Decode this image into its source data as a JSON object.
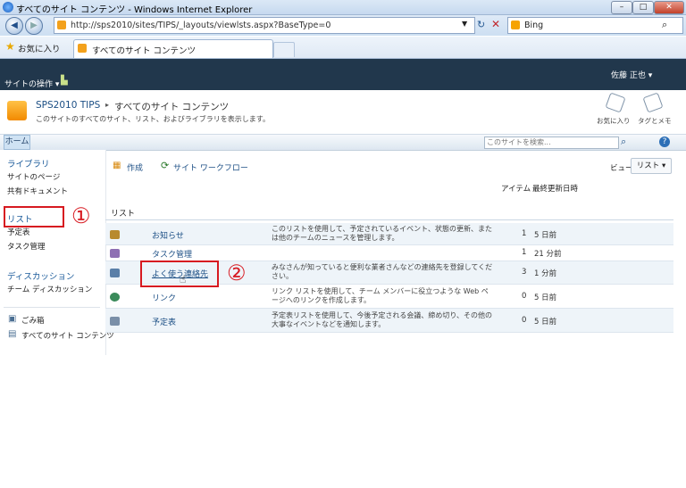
{
  "window": {
    "title": "すべてのサイト コンテンツ - Windows Internet Explorer"
  },
  "browser": {
    "url": "http://sps2010/sites/TIPS/_layouts/viewlsts.aspx?BaseType=0",
    "search_engine": "Bing",
    "favorites_label": "お気に入り",
    "tab_title": "すべてのサイト コンテンツ"
  },
  "ribbon": {
    "site_actions": "サイトの操作 ▾",
    "user": "佐藤 正也 ▾"
  },
  "breadcrumb": {
    "site": "SPS2010 TIPS",
    "separator": "▸",
    "page": "すべてのサイト コンテンツ",
    "description": "このサイトのすべてのサイト、リスト、およびライブラリを表示します。",
    "like": "お気に入り",
    "tags": "タグとメモ"
  },
  "topnav": {
    "home": "ホーム",
    "search_placeholder": "このサイトを検索..."
  },
  "leftnav": {
    "libraries": "ライブラリ",
    "site_pages": "サイトのページ",
    "shared_docs": "共有ドキュメント",
    "lists": "リスト",
    "calendar": "予定表",
    "tasks": "タスク管理",
    "discussions": "ディスカッション",
    "team_discussion": "チーム ディスカッション",
    "recycle_bin": "ごみ箱",
    "all_content": "すべてのサイト コンテンツ"
  },
  "toolbar": {
    "create": "作成",
    "workflow": "サイト ワークフロー",
    "view_label": "ビュー:",
    "view_value": "リスト ▾"
  },
  "columns": {
    "items": "アイテム",
    "modified": "最終更新日時"
  },
  "section": "リスト",
  "lists": [
    {
      "name": "お知らせ",
      "desc": "このリストを使用して、予定されているイベント、状態の更新、または他のチームのニュースを管理します。",
      "count": "1",
      "time": "5 日前"
    },
    {
      "name": "タスク管理",
      "desc": "",
      "count": "1",
      "time": "21 分前"
    },
    {
      "name": "よく使う連絡先",
      "desc": "みなさんが知っていると便利な業者さんなどの連絡先を登録してください。",
      "count": "3",
      "time": "1 分前"
    },
    {
      "name": "リンク",
      "desc": "リンク リストを使用して、チーム メンバーに役立つような Web ページへのリンクを作成します。",
      "count": "0",
      "time": "5 日前"
    },
    {
      "name": "予定表",
      "desc": "予定表リストを使用して、今後予定される会議、締め切り、その他の大事なイベントなどを通知します。",
      "count": "0",
      "time": "5 日前"
    }
  ],
  "callouts": {
    "one": "①",
    "two": "②"
  }
}
